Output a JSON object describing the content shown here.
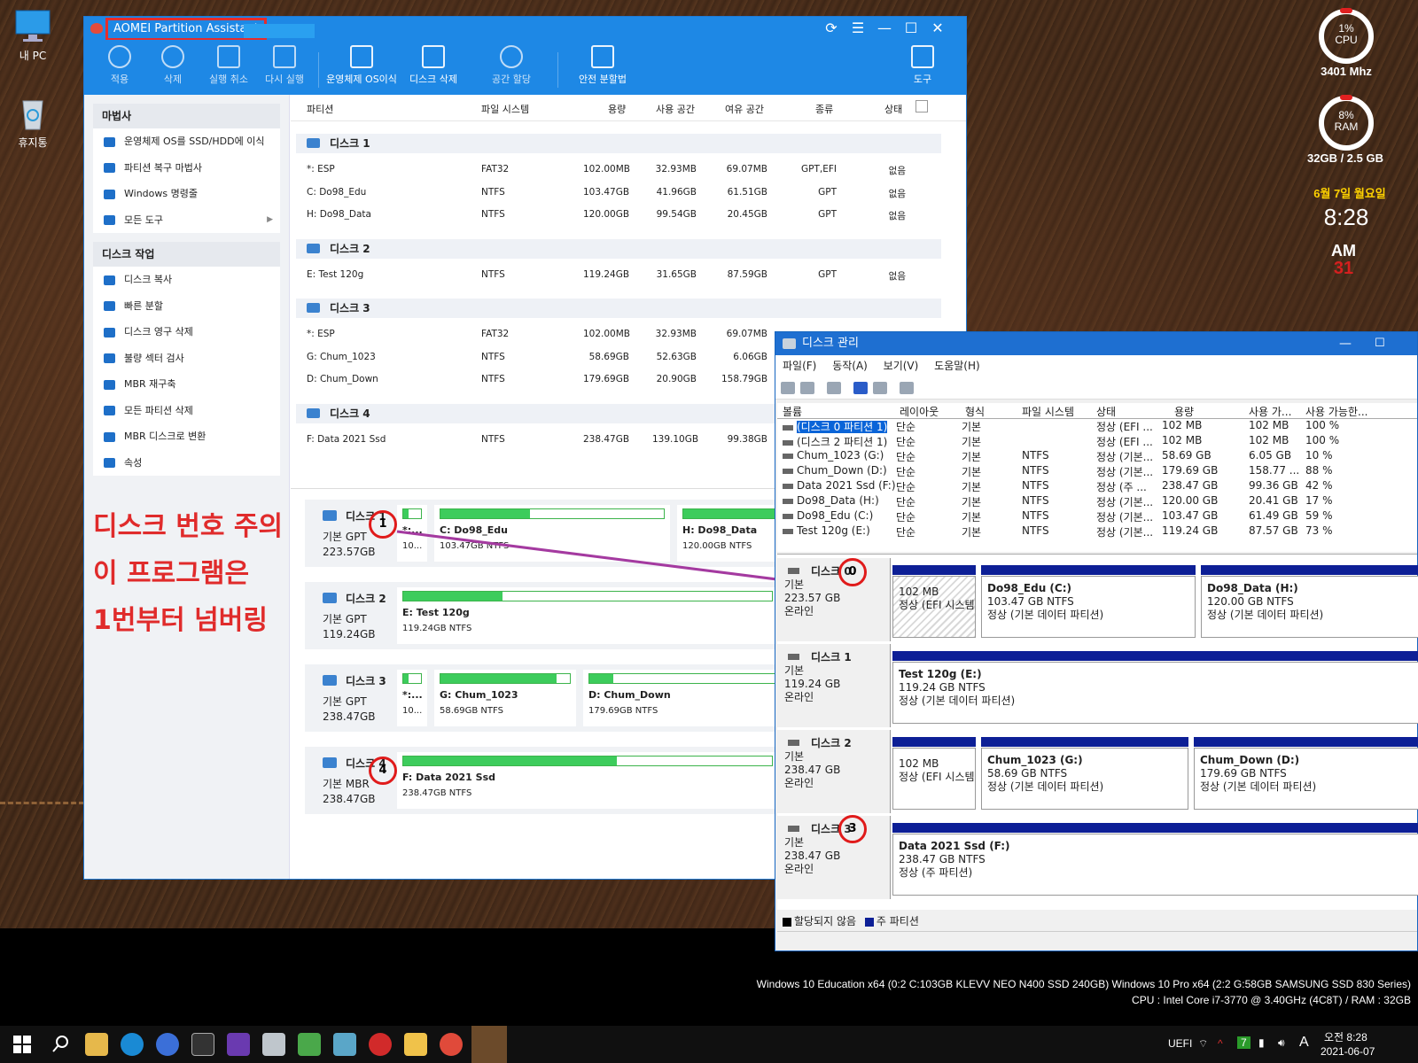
{
  "desktop": {
    "icons": [
      {
        "label": "내 PC"
      },
      {
        "label": "휴지통"
      }
    ],
    "cpu": {
      "pct": "1%",
      "label": "CPU",
      "freq": "3401 Mhz"
    },
    "ram": {
      "pct": "8%",
      "label": "RAM",
      "usage": "32GB / 2.5 GB"
    },
    "date": "6월 7일 월요일",
    "clock": "8:28",
    "ampm": "AM",
    "day": "31",
    "sysinfo1": "Windows 10 Education x64 (0:2 C:103GB KLEVV NEO N400 SSD 240GB) Windows 10 Pro x64 (2:2 G:58GB SAMSUNG SSD 830 Series)",
    "sysinfo2": "CPU : Intel Core i7-3770 @ 3.40GHz (4C8T) / RAM : 32GB"
  },
  "aomei": {
    "title": "AOMEI Partition Assistant",
    "toolbar": [
      {
        "label": "적용",
        "icon": "check-icon"
      },
      {
        "label": "삭제",
        "icon": "discard-icon"
      },
      {
        "label": "실행 취소",
        "icon": "undo-icon"
      },
      {
        "label": "다시 실행",
        "icon": "redo-icon"
      },
      {
        "label": "운영체제 OS이식",
        "icon": "migrate-os-icon"
      },
      {
        "label": "디스크 삭제",
        "icon": "wipe-disk-icon"
      },
      {
        "label": "공간 할당",
        "icon": "allocate-space-icon"
      },
      {
        "label": "안전 분할법",
        "icon": "shield-icon"
      },
      {
        "label": "도구",
        "icon": "wrench-icon"
      }
    ],
    "wizard": {
      "title": "마법사",
      "items": [
        {
          "label": "운영체제 OS를 SSD/HDD에 이식"
        },
        {
          "label": "파티션 복구 마법사"
        },
        {
          "label": "Windows 명령줄"
        },
        {
          "label": "모든 도구"
        }
      ]
    },
    "disk_ops": {
      "title": "디스크 작업",
      "items": [
        {
          "label": "디스크 복사"
        },
        {
          "label": "빠른 분할"
        },
        {
          "label": "디스크 영구 삭제"
        },
        {
          "label": "불량 섹터 검사"
        },
        {
          "label": "MBR 재구축"
        },
        {
          "label": "모든 파티션 삭제"
        },
        {
          "label": "MBR 디스크로 변환"
        },
        {
          "label": "속성"
        }
      ]
    },
    "columns": [
      "파티션",
      "파일 시스템",
      "용량",
      "사용 공간",
      "여유 공간",
      "종류",
      "상태"
    ],
    "disks": [
      {
        "title": "디스크 1",
        "rows": [
          [
            "*: ESP",
            "FAT32",
            "102.00MB",
            "32.93MB",
            "69.07MB",
            "GPT,EFI",
            "없음"
          ],
          [
            "C: Do98_Edu",
            "NTFS",
            "103.47GB",
            "41.96GB",
            "61.51GB",
            "GPT",
            "없음"
          ],
          [
            "H: Do98_Data",
            "NTFS",
            "120.00GB",
            "99.54GB",
            "20.45GB",
            "GPT",
            "없음"
          ]
        ]
      },
      {
        "title": "디스크 2",
        "rows": [
          [
            "E: Test 120g",
            "NTFS",
            "119.24GB",
            "31.65GB",
            "87.59GB",
            "GPT",
            "없음"
          ]
        ]
      },
      {
        "title": "디스크 3",
        "rows": [
          [
            "*: ESP",
            "FAT32",
            "102.00MB",
            "32.93MB",
            "69.07MB",
            "",
            ""
          ],
          [
            "G: Chum_1023",
            "NTFS",
            "58.69GB",
            "52.63GB",
            "6.06GB",
            "",
            ""
          ],
          [
            "D: Chum_Down",
            "NTFS",
            "179.69GB",
            "20.90GB",
            "158.79GB",
            "",
            ""
          ]
        ]
      },
      {
        "title": "디스크 4",
        "rows": [
          [
            "F: Data 2021 Ssd",
            "NTFS",
            "238.47GB",
            "139.10GB",
            "99.38GB",
            "",
            ""
          ]
        ]
      }
    ],
    "map": [
      {
        "name": "디스크",
        "num": "1",
        "type": "기본 GPT",
        "size": "223.57GB",
        "parts": [
          {
            "name": "*:...",
            "info": "10...",
            "fill": 0.3
          },
          {
            "name": "C: Do98_Edu",
            "info": "103.47GB NTFS",
            "fill": 0.4
          },
          {
            "name": "H: Do98_Data",
            "info": "120.00GB NTFS",
            "fill": 0.83
          }
        ]
      },
      {
        "name": "디스크",
        "num": "2",
        "type": "기본 GPT",
        "size": "119.24GB",
        "parts": [
          {
            "name": "E: Test 120g",
            "info": "119.24GB NTFS",
            "fill": 0.27
          }
        ]
      },
      {
        "name": "디스크",
        "num": "3",
        "type": "기본 GPT",
        "size": "238.47GB",
        "parts": [
          {
            "name": "*:...",
            "info": "10...",
            "fill": 0.3
          },
          {
            "name": "G: Chum_1023",
            "info": "58.69GB NTFS",
            "fill": 0.9
          },
          {
            "name": "D: Chum_Down",
            "info": "179.69GB NTFS",
            "fill": 0.12
          }
        ]
      },
      {
        "name": "디스크",
        "num": "4",
        "type": "기본 MBR",
        "size": "238.47GB",
        "parts": [
          {
            "name": "F: Data 2021 Ssd",
            "info": "238.47GB NTFS",
            "fill": 0.58
          }
        ]
      }
    ]
  },
  "annotation": {
    "line1": "디스크 번호 주의",
    "line2": "이 프로그램은",
    "line3": "1번부터 넘버링"
  },
  "diskmgmt": {
    "title": "디스크 관리",
    "menu": [
      "파일(F)",
      "동작(A)",
      "보기(V)",
      "도움말(H)"
    ],
    "columns": [
      "볼륨",
      "레이아웃",
      "형식",
      "파일 시스템",
      "상태",
      "용량",
      "사용 가...",
      "사용 가능한..."
    ],
    "volumes": [
      [
        "(디스크 0 파티션 1)",
        "단순",
        "기본",
        "",
        "정상 (EFI ...",
        "102 MB",
        "102 MB",
        "100 %"
      ],
      [
        "(디스크 2 파티션 1)",
        "단순",
        "기본",
        "",
        "정상 (EFI ...",
        "102 MB",
        "102 MB",
        "100 %"
      ],
      [
        "Chum_1023 (G:)",
        "단순",
        "기본",
        "NTFS",
        "정상 (기본...",
        "58.69 GB",
        "6.05 GB",
        "10 %"
      ],
      [
        "Chum_Down (D:)",
        "단순",
        "기본",
        "NTFS",
        "정상 (기본...",
        "179.69 GB",
        "158.77 ...",
        "88 %"
      ],
      [
        "Data 2021 Ssd (F:)",
        "단순",
        "기본",
        "NTFS",
        "정상 (주 ...",
        "238.47 GB",
        "99.36 GB",
        "42 %"
      ],
      [
        "Do98_Data (H:)",
        "단순",
        "기본",
        "NTFS",
        "정상 (기본...",
        "120.00 GB",
        "20.41 GB",
        "17 %"
      ],
      [
        "Do98_Edu (C:)",
        "단순",
        "기본",
        "NTFS",
        "정상 (기본...",
        "103.47 GB",
        "61.49 GB",
        "59 %"
      ],
      [
        "Test 120g (E:)",
        "단순",
        "기본",
        "NTFS",
        "정상 (기본...",
        "119.24 GB",
        "87.57 GB",
        "73 %"
      ]
    ],
    "disks": [
      {
        "name": "디스크",
        "num": "0",
        "type": "기본",
        "size": "223.57 GB",
        "state": "온라인",
        "parts": [
          {
            "title": "",
            "l1": "102 MB",
            "l2": "정상 (EFI 시스템"
          },
          {
            "title": "Do98_Edu  (C:)",
            "l1": "103.47 GB NTFS",
            "l2": "정상 (기본 데이터 파티션)"
          },
          {
            "title": "Do98_Data  (H:)",
            "l1": "120.00 GB NTFS",
            "l2": "정상 (기본 데이터 파티션)"
          }
        ]
      },
      {
        "name": "디스크",
        "num": "1",
        "type": "기본",
        "size": "119.24 GB",
        "state": "온라인",
        "parts": [
          {
            "title": "Test 120g  (E:)",
            "l1": "119.24 GB NTFS",
            "l2": "정상 (기본 데이터 파티션)"
          }
        ]
      },
      {
        "name": "디스크",
        "num": "2",
        "type": "기본",
        "size": "238.47 GB",
        "state": "온라인",
        "parts": [
          {
            "title": "",
            "l1": "102 MB",
            "l2": "정상 (EFI 시스템"
          },
          {
            "title": "Chum_1023  (G:)",
            "l1": "58.69 GB NTFS",
            "l2": "정상 (기본 데이터 파티션)"
          },
          {
            "title": "Chum_Down  (D:)",
            "l1": "179.69 GB NTFS",
            "l2": "정상 (기본 데이터 파티션)"
          }
        ]
      },
      {
        "name": "디스크",
        "num": "3",
        "type": "기본",
        "size": "238.47 GB",
        "state": "온라인",
        "parts": [
          {
            "title": "Data 2021 Ssd  (F:)",
            "l1": "238.47 GB NTFS",
            "l2": "정상 (주 파티션)"
          }
        ]
      }
    ],
    "legend": [
      "할당되지 않음",
      "주 파티션"
    ]
  },
  "taskbar": {
    "uefi": "UEFI",
    "ime": "A",
    "time": "오전 8:28",
    "date": "2021-06-07",
    "badge": "7"
  }
}
